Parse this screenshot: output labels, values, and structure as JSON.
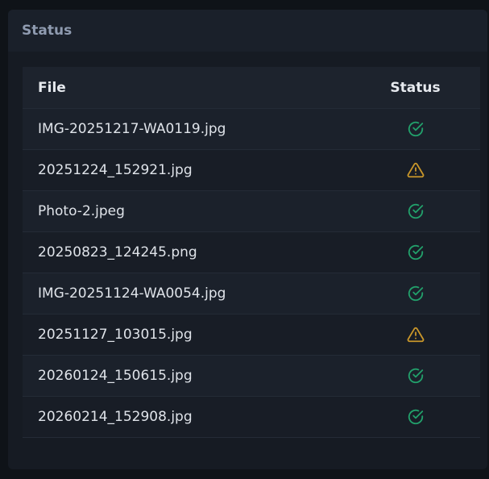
{
  "panel": {
    "title": "Status"
  },
  "table": {
    "columns": [
      "File",
      "Status"
    ],
    "rows": [
      {
        "file": "IMG-20251217-WA0119.jpg",
        "status": "success",
        "icon": "check-circle-icon"
      },
      {
        "file": "20251224_152921.jpg",
        "status": "warning",
        "icon": "warning-triangle-icon"
      },
      {
        "file": "Photo-2.jpeg",
        "status": "success",
        "icon": "check-circle-icon"
      },
      {
        "file": "20250823_124245.png",
        "status": "success",
        "icon": "check-circle-icon"
      },
      {
        "file": "IMG-20251124-WA0054.jpg",
        "status": "success",
        "icon": "check-circle-icon"
      },
      {
        "file": "20251127_103015.jpg",
        "status": "warning",
        "icon": "warning-triangle-icon"
      },
      {
        "file": "20260124_150615.jpg",
        "status": "success",
        "icon": "check-circle-icon"
      },
      {
        "file": "20260214_152908.jpg",
        "status": "success",
        "icon": "check-circle-icon"
      }
    ]
  },
  "colors": {
    "success": "#22a06b",
    "warning": "#c8962a"
  }
}
